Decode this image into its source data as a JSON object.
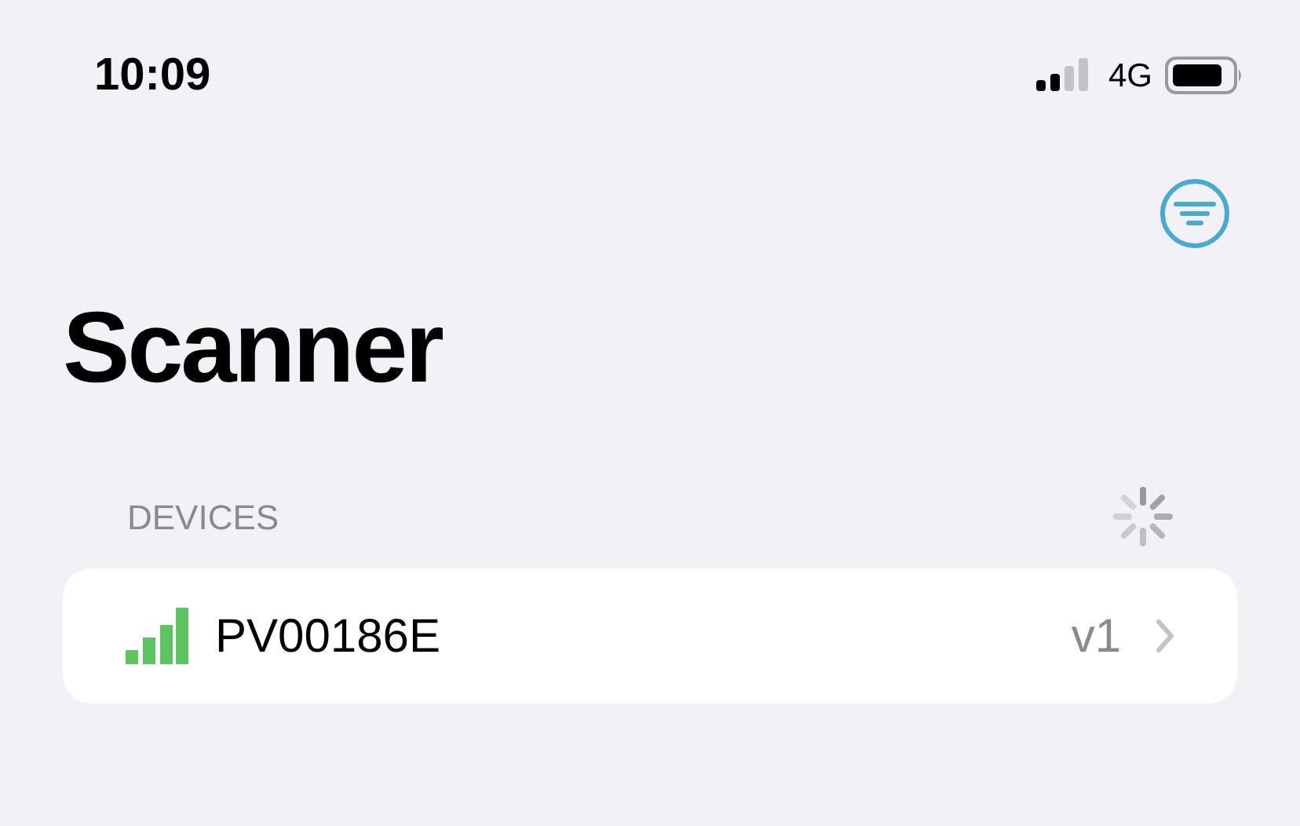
{
  "status_bar": {
    "time": "10:09",
    "network": "4G"
  },
  "title": "Scanner",
  "section": {
    "header": "DEVICES",
    "loading": true
  },
  "devices": [
    {
      "name": "PV00186E",
      "version": "v1"
    }
  ]
}
